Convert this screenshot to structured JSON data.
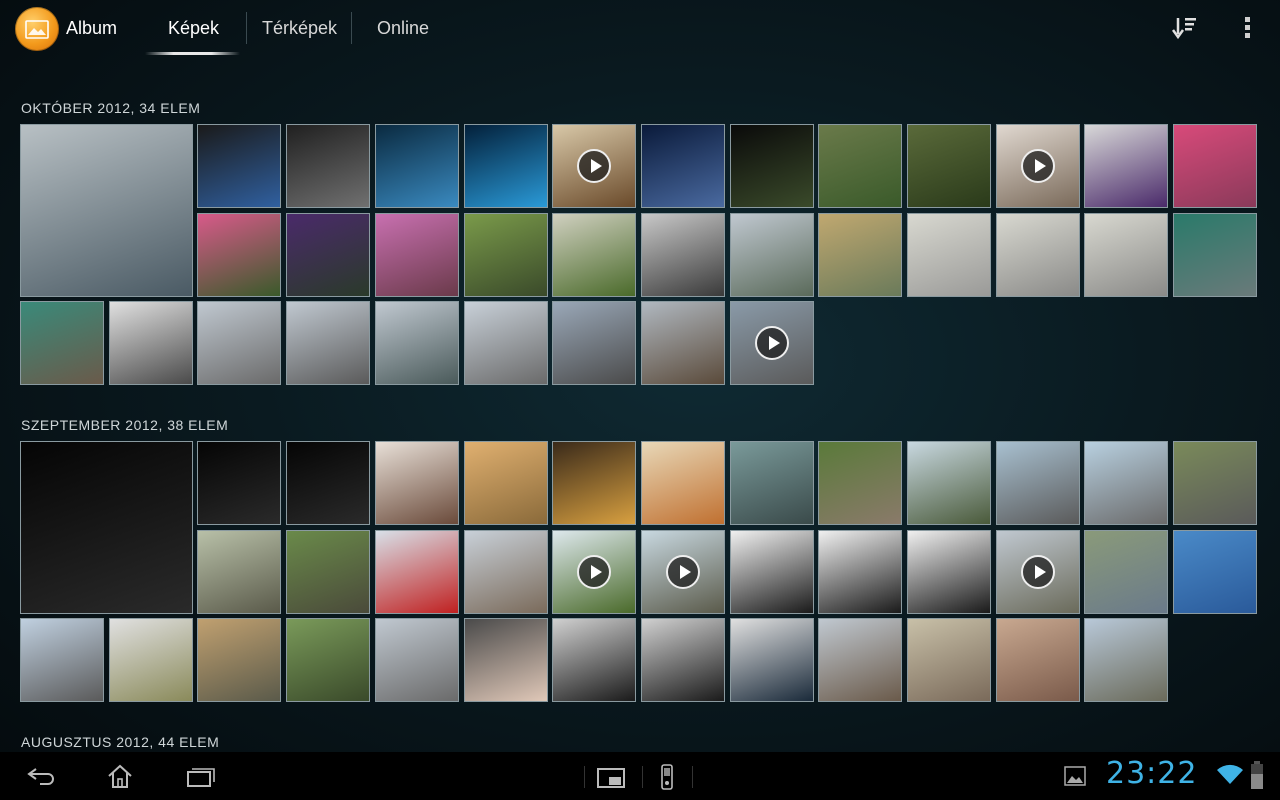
{
  "actionbar": {
    "app_title": "Album",
    "tabs": [
      {
        "label": "Képek",
        "active": true
      },
      {
        "label": "Térképek",
        "active": false
      },
      {
        "label": "Online",
        "active": false
      }
    ],
    "icons": [
      "app-album-icon",
      "sort-icon",
      "overflow-menu-icon"
    ]
  },
  "sections": [
    {
      "label": "OKTÓBER 2012, 34 ELEM"
    },
    {
      "label": "SZEPTEMBER 2012, 38 ELEM"
    },
    {
      "label": "AUGUSZTUS 2012, 44 ELEM"
    }
  ],
  "grid": {
    "sections": [
      {
        "thumbs": [
          {
            "c": [
              "#b8c0c4",
              "#4a5a64"
            ],
            "play": false
          },
          {
            "c": [
              "#1a1a1a",
              "#3060a0"
            ],
            "play": false
          },
          {
            "c": [
              "#202020",
              "#707070"
            ],
            "play": false
          },
          {
            "c": [
              "#0a2a40",
              "#3a8ac0"
            ],
            "play": false
          },
          {
            "c": [
              "#03203a",
              "#2a9ad8"
            ],
            "play": false
          },
          {
            "c": [
              "#d8c8a8",
              "#6a4a2a"
            ],
            "play": true
          },
          {
            "c": [
              "#0a1a3a",
              "#4a6aa0"
            ],
            "play": false
          },
          {
            "c": [
              "#0a0a0a",
              "#3a4a2a"
            ],
            "play": false
          },
          {
            "c": [
              "#6a7a4a",
              "#3a5a2a"
            ],
            "play": false
          },
          {
            "c": [
              "#5a6a3a",
              "#2a3a1a"
            ],
            "play": false
          },
          {
            "c": [
              "#e0d8d0",
              "#7a6a5a"
            ],
            "play": true
          },
          {
            "c": [
              "#d8d8d8",
              "#4a2a6a"
            ],
            "play": false
          },
          {
            "c": [
              "#d84a7a",
              "#8a3a5a"
            ],
            "play": false
          },
          {
            "c": [
              "#d85a8a",
              "#3a5a2a"
            ],
            "play": false
          },
          {
            "c": [
              "#4a2a6a",
              "#2a3a2a"
            ],
            "play": false
          },
          {
            "c": [
              "#c870b0",
              "#6a3a4a"
            ],
            "play": false
          },
          {
            "c": [
              "#7a9a4a",
              "#3a4a2a"
            ],
            "play": false
          },
          {
            "c": [
              "#d0d0c0",
              "#4a6a2a"
            ],
            "play": false
          },
          {
            "c": [
              "#c8c8c8",
              "#3a3a3a"
            ],
            "play": false
          },
          {
            "c": [
              "#c0c8d0",
              "#5a6a5a"
            ],
            "play": false
          },
          {
            "c": [
              "#c0a870",
              "#6a7a5a"
            ],
            "play": false
          },
          {
            "c": [
              "#d8d8d0",
              "#9a9a98"
            ],
            "play": false
          },
          {
            "c": [
              "#d8d8d0",
              "#8a8a88"
            ],
            "play": false
          },
          {
            "c": [
              "#d8d8d0",
              "#8a8a88"
            ],
            "play": false
          },
          {
            "c": [
              "#2a7a6a",
              "#6a7a7a"
            ],
            "play": false
          },
          {
            "c": [
              "#3a8a7a",
              "#6a5a4a"
            ],
            "play": false
          },
          {
            "c": [
              "#e0e0e0",
              "#4a4a4a"
            ],
            "play": false
          },
          {
            "c": [
              "#c0c8d0",
              "#6a6a6a"
            ],
            "play": false
          },
          {
            "c": [
              "#c0c8d0",
              "#5a5a5a"
            ],
            "play": false
          },
          {
            "c": [
              "#c0c8d0",
              "#4a5a5a"
            ],
            "play": false
          },
          {
            "c": [
              "#c8d0d8",
              "#6a6a6a"
            ],
            "play": false
          },
          {
            "c": [
              "#9aa8b8",
              "#4a4a4a"
            ],
            "play": false
          },
          {
            "c": [
              "#b0b8c0",
              "#5a4a3a"
            ],
            "play": false
          },
          {
            "c": [
              "#8a9aa8",
              "#5a5a5a"
            ],
            "play": true
          }
        ]
      },
      {
        "thumbs": [
          {
            "c": [
              "#050505",
              "#2a2a2a"
            ],
            "play": false
          },
          {
            "c": [
              "#050505",
              "#2a2a2a"
            ],
            "play": false
          },
          {
            "c": [
              "#050505",
              "#2a2a2a"
            ],
            "play": false
          },
          {
            "c": [
              "#e8e0d8",
              "#6a4a3a"
            ],
            "play": false
          },
          {
            "c": [
              "#e0b070",
              "#8a6a3a"
            ],
            "play": false
          },
          {
            "c": [
              "#3a2a1a",
              "#d8a040"
            ],
            "play": false
          },
          {
            "c": [
              "#e8d8b8",
              "#c07030"
            ],
            "play": false
          },
          {
            "c": [
              "#7a9a9a",
              "#3a4a4a"
            ],
            "play": false
          },
          {
            "c": [
              "#5a7a3a",
              "#8a7a6a"
            ],
            "play": false
          },
          {
            "c": [
              "#c8d8e0",
              "#4a5a3a"
            ],
            "play": false
          },
          {
            "c": [
              "#a8c0d0",
              "#5a5a5a"
            ],
            "play": false
          },
          {
            "c": [
              "#b8d0e0",
              "#6a6a6a"
            ],
            "play": false
          },
          {
            "c": [
              "#7a8a5a",
              "#5a5a5a"
            ],
            "play": false
          },
          {
            "c": [
              "#b8c0a8",
              "#5a5a4a"
            ],
            "play": false
          },
          {
            "c": [
              "#6a8a4a",
              "#4a4a3a"
            ],
            "play": false
          },
          {
            "c": [
              "#d8e0e8",
              "#c02020"
            ],
            "play": false
          },
          {
            "c": [
              "#c8d0d8",
              "#7a6a5a"
            ],
            "play": false
          },
          {
            "c": [
              "#dde8ec",
              "#4a6a2a"
            ],
            "play": true
          },
          {
            "c": [
              "#c8d8e0",
              "#5a5a4a"
            ],
            "play": true
          },
          {
            "c": [
              "#f0f0f0",
              "#1a1a1a"
            ],
            "play": false
          },
          {
            "c": [
              "#f0f0f0",
              "#1a1a1a"
            ],
            "play": false
          },
          {
            "c": [
              "#f0f0f0",
              "#1a1a1a"
            ],
            "play": false
          },
          {
            "c": [
              "#c0c8d0",
              "#6a6a5a"
            ],
            "play": true
          },
          {
            "c": [
              "#8a9a7a",
              "#6a7a8a"
            ],
            "play": false
          },
          {
            "c": [
              "#4a8ac8",
              "#2a5a9a"
            ],
            "play": false
          },
          {
            "c": [
              "#c0d0e0",
              "#5a5a5a"
            ],
            "play": false
          },
          {
            "c": [
              "#e0e0e0",
              "#8a8a5a"
            ],
            "play": false
          },
          {
            "c": [
              "#c0a070",
              "#5a5a4a"
            ],
            "play": false
          },
          {
            "c": [
              "#7a9a5a",
              "#3a4a2a"
            ],
            "play": false
          },
          {
            "c": [
              "#c0c8d0",
              "#6a6a6a"
            ],
            "play": false
          },
          {
            "c": [
              "#4a4a4a",
              "#e0c8b8"
            ],
            "play": false
          },
          {
            "c": [
              "#d0d0d0",
              "#1a1a1a"
            ],
            "play": false
          },
          {
            "c": [
              "#d0d0d0",
              "#1a1a1a"
            ],
            "play": false
          },
          {
            "c": [
              "#e0e0e0",
              "#1a2a3a"
            ],
            "play": false
          },
          {
            "c": [
              "#c0c8d0",
              "#6a5a4a"
            ],
            "play": false
          },
          {
            "c": [
              "#c8c0a8",
              "#7a6a5a"
            ],
            "play": false
          },
          {
            "c": [
              "#c8a890",
              "#7a5a4a"
            ],
            "play": false
          },
          {
            "c": [
              "#b8c8d8",
              "#6a6a5a"
            ],
            "play": false
          }
        ]
      }
    ]
  },
  "sysbar": {
    "time": "23:22",
    "icons": [
      "back-icon",
      "home-icon",
      "recent-apps-icon",
      "screenshot-icon",
      "usb-icon",
      "gallery-notification-icon",
      "wifi-icon",
      "battery-icon"
    ]
  },
  "colors": {
    "accent_clock": "#3fb3e6",
    "thumb_border": "#8a9aa0"
  }
}
